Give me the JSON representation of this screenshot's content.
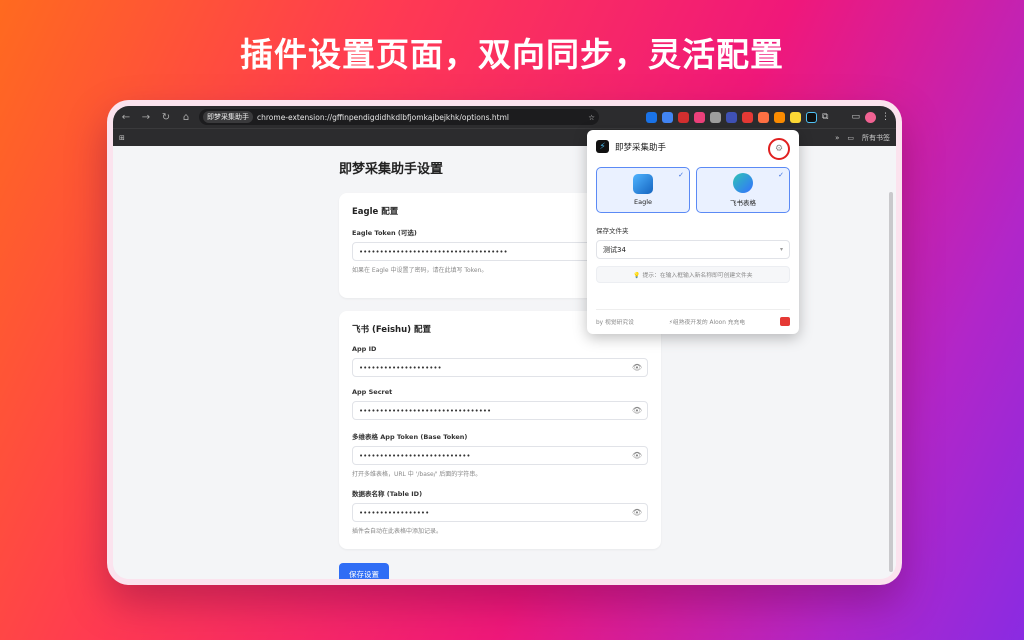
{
  "headline": "插件设置页面，双向同步，灵活配置",
  "browser": {
    "site_chip": "即梦采集助手",
    "url": "chrome-extension://gffinpendigdidhkdlbfjomkajbejkhk/options.html",
    "bookmark_label": "所有书签"
  },
  "settings": {
    "title": "即梦采集助手设置",
    "eagle": {
      "heading": "Eagle 配置",
      "token_label": "Eagle Token (可选)",
      "token_value": "••••••••••••••••••••••••••••••••••••",
      "hint": "如果在 Eagle 中设置了密码，请在此填写 Token。"
    },
    "feishu": {
      "heading": "飞书 (Feishu) 配置",
      "app_id_label": "App ID",
      "app_id_value": "••••••••••••••••••••",
      "app_secret_label": "App Secret",
      "app_secret_value": "••••••••••••••••••••••••••••••••",
      "base_token_label": "多维表格 App Token (Base Token)",
      "base_token_value": "•••••••••••••••••••••••••••",
      "base_token_hint": "打开多维表格，URL 中 '/base/' 后面的字符串。",
      "table_id_label": "数据表名称 (Table ID)",
      "table_id_value": "•••••••••••••••••",
      "table_id_hint": "插件会自动在此表格中添加记录。"
    },
    "save_label": "保存设置"
  },
  "popup": {
    "title": "即梦采集助手",
    "target_eagle": "Eagle",
    "target_feishu": "飞书表格",
    "folder_label": "保存文件夹",
    "folder_value": "测试34",
    "tip": "💡 提示：在输入框输入新名称即可创建文件夹",
    "footer_left": "by 视觉研究设",
    "footer_mid": "⚡组熟夜开发的 Aloon 充充电"
  },
  "colors": {
    "primary": "#2f6df5",
    "highlight_ring": "#e02020"
  }
}
